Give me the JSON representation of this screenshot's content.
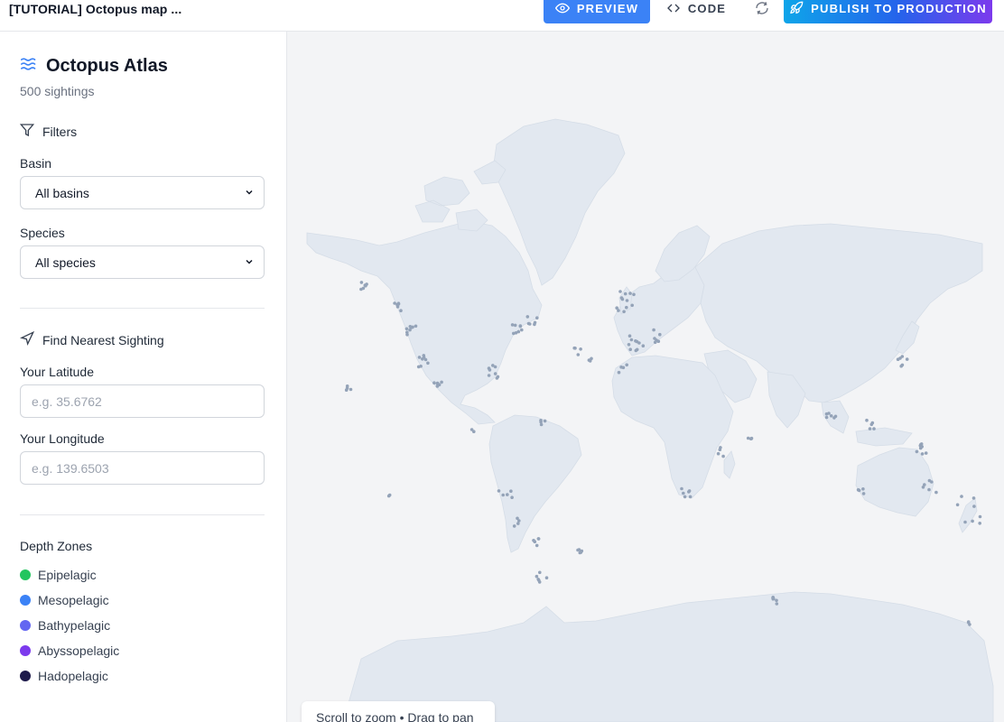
{
  "topbar": {
    "title": "[TUTORIAL] Octopus map ...",
    "preview_label": "PREVIEW",
    "code_label": "CODE",
    "publish_label": "PUBLISH TO PRODUCTION"
  },
  "sidebar": {
    "title": "Octopus Atlas",
    "subtitle": "500 sightings",
    "filters": {
      "heading": "Filters",
      "basin_label": "Basin",
      "basin_value": "All basins",
      "species_label": "Species",
      "species_value": "All species"
    },
    "nearest": {
      "heading": "Find Nearest Sighting",
      "lat_label": "Your Latitude",
      "lat_placeholder": "e.g. 35.6762",
      "lng_label": "Your Longitude",
      "lng_placeholder": "e.g. 139.6503"
    },
    "legend": {
      "title": "Depth Zones",
      "items": [
        {
          "label": "Epipelagic",
          "color": "#22c55e"
        },
        {
          "label": "Mesopelagic",
          "color": "#3b82f6"
        },
        {
          "label": "Bathypelagic",
          "color": "#6366f1"
        },
        {
          "label": "Abyssopelagic",
          "color": "#7c3aed"
        },
        {
          "label": "Hadopelagic",
          "color": "#1e1b4b"
        }
      ]
    }
  },
  "map": {
    "hint": "Scroll to zoom • Drag to pan",
    "land_color": "#e2e8f0",
    "ocean_color": "#f3f4f6",
    "marker_color": "#94a3b8"
  }
}
